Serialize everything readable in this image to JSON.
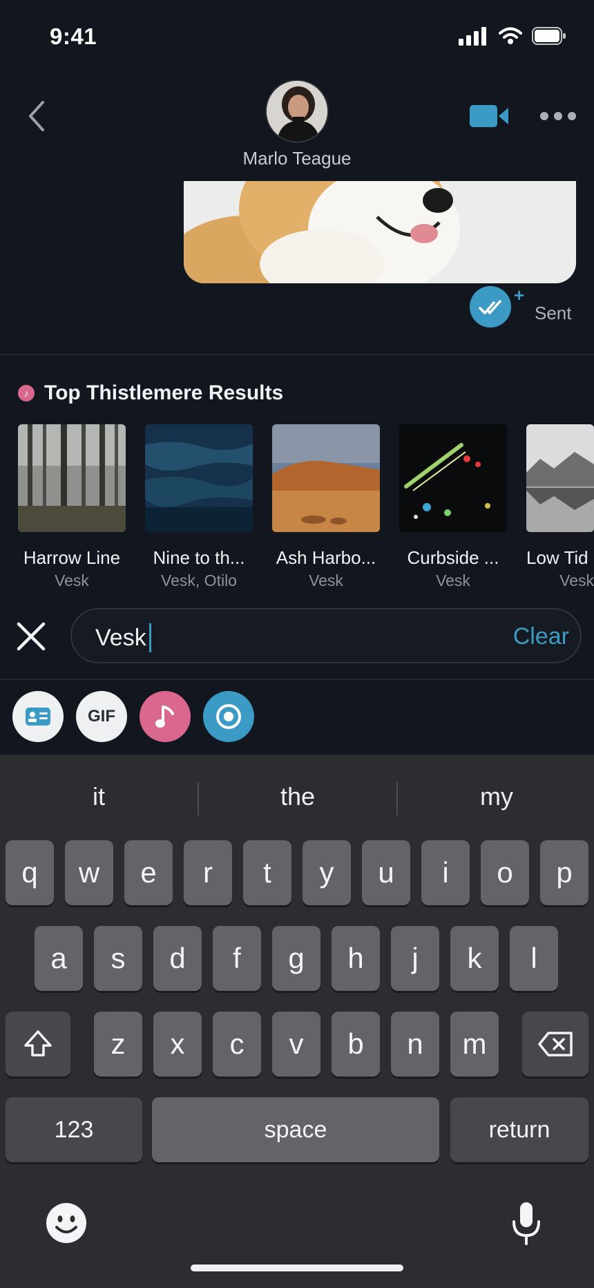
{
  "status_bar": {
    "time": "9:41"
  },
  "header": {
    "contact_name": "Marlo Teague"
  },
  "message": {
    "status": "Sent",
    "plus_glyph": "+"
  },
  "results": {
    "title": "Top Thistlemere Results",
    "tracks": [
      {
        "title": "Harrow Line",
        "artist": "Vesk"
      },
      {
        "title": "Nine to th...",
        "artist": "Vesk, Otilo"
      },
      {
        "title": "Ash Harbo...",
        "artist": "Vesk"
      },
      {
        "title": "Curbside ...",
        "artist": "Vesk"
      },
      {
        "title": "Low Tid",
        "artist": "Vesk"
      }
    ]
  },
  "search": {
    "value": "Vesk",
    "clear_label": "Clear"
  },
  "attachments": {
    "gif_label": "GIF"
  },
  "keyboard": {
    "suggestions": [
      "it",
      "the",
      "my"
    ],
    "row1": [
      "q",
      "w",
      "e",
      "r",
      "t",
      "y",
      "u",
      "i",
      "o",
      "p"
    ],
    "row2": [
      "a",
      "s",
      "d",
      "f",
      "g",
      "h",
      "j",
      "k",
      "l"
    ],
    "row3": [
      "z",
      "x",
      "c",
      "v",
      "b",
      "n",
      "m"
    ],
    "numbers_label": "123",
    "space_label": "space",
    "return_label": "return"
  },
  "colors": {
    "accent": "#3b9bc4",
    "music": "#d9678e",
    "background": "#12161e"
  }
}
